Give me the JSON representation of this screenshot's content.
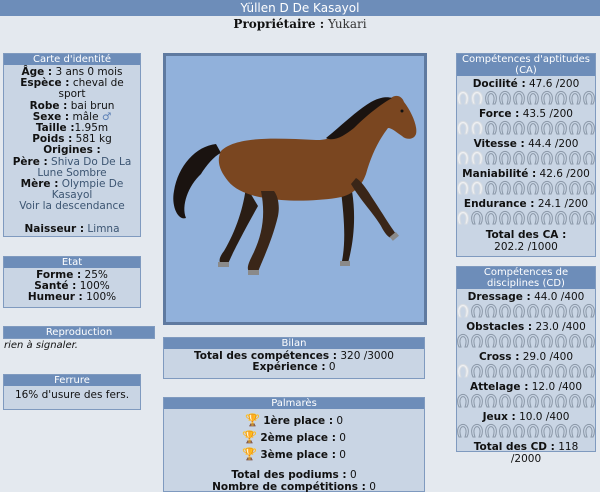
{
  "title": "Yüllen D De Kasayol",
  "owner": {
    "label": "Propriétaire :",
    "value": "Yukari"
  },
  "identity": {
    "header": "Carte d'identité",
    "age_label": "Âge :",
    "age": "3 ans 0 mois",
    "species_label": "Espèce :",
    "species": "cheval de sport",
    "coat_label": "Robe :",
    "coat": "bai brun",
    "sex_label": "Sexe :",
    "sex": "mâle",
    "height_label": "Taille :",
    "height": "1.95m",
    "weight_label": "Poids :",
    "weight": "581 kg",
    "origins_label": "Origines :",
    "father_label": "Père :",
    "father": "Shiva Do De La Lune Sombre",
    "mother_label": "Mère :",
    "mother": "Olympie De Kasayol",
    "descendants": "Voir la descendance",
    "breeder_label": "Naisseur :",
    "breeder": "Limna"
  },
  "state": {
    "header": "Etat",
    "form_label": "Forme :",
    "form": "25%",
    "health_label": "Santé :",
    "health": "100%",
    "mood_label": "Humeur :",
    "mood": "100%"
  },
  "reproduction": {
    "header": "Reproduction",
    "text": "rien à signaler."
  },
  "shoeing": {
    "header": "Ferrure",
    "text": "16% d'usure des fers."
  },
  "bilan": {
    "header": "Bilan",
    "total_label": "Total des compétences :",
    "total": "320 /3000",
    "exp_label": "Expérience :",
    "exp": "0"
  },
  "palmares": {
    "header": "Palmarès",
    "first_label": "1ère place :",
    "first": "0",
    "second_label": "2ème place :",
    "second": "0",
    "third_label": "3ème place :",
    "third": "0",
    "podiums_label": "Total des podiums :",
    "podiums": "0",
    "comps_label": "Nombre de compétitions :",
    "comps": "0"
  },
  "ca": {
    "header": "Compétences d'aptitudes (CA)",
    "items": [
      {
        "label": "Docilité :",
        "value": "47.6 /200",
        "filled": 2
      },
      {
        "label": "Force :",
        "value": "43.5 /200",
        "filled": 2
      },
      {
        "label": "Vitesse :",
        "value": "44.4 /200",
        "filled": 2
      },
      {
        "label": "Maniabilité :",
        "value": "42.6 /200",
        "filled": 2
      },
      {
        "label": "Endurance :",
        "value": "24.1 /200",
        "filled": 1
      }
    ],
    "total_label": "Total des CA :",
    "total": "202.2 /1000"
  },
  "cd": {
    "header": "Compétences de disciplines (CD)",
    "items": [
      {
        "label": "Dressage :",
        "value": "44.0 /400",
        "filled": 1
      },
      {
        "label": "Obstacles :",
        "value": "23.0 /400",
        "filled": 0
      },
      {
        "label": "Cross :",
        "value": "29.0 /400",
        "filled": 1
      },
      {
        "label": "Attelage :",
        "value": "12.0 /400",
        "filled": 0
      },
      {
        "label": "Jeux :",
        "value": "10.0 /400",
        "filled": 0
      }
    ],
    "total_label": "Total des CD :",
    "total": "118 /2000"
  },
  "colors": {
    "header": "#6d8db9",
    "panel": "#c9d5e4",
    "background": "#e4e9ef",
    "horse_bg": "#91b1db"
  }
}
